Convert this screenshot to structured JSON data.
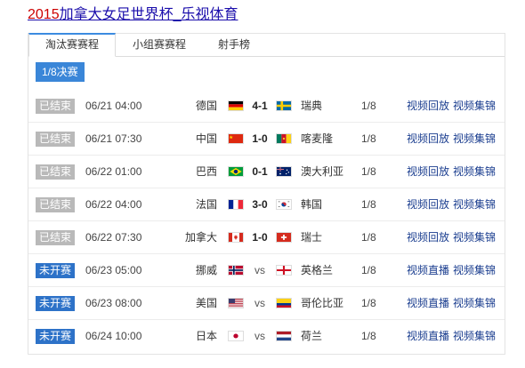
{
  "header": {
    "title_highlight": "2015",
    "title_rest": "加拿大女足世界杯_乐视体育"
  },
  "tabs": [
    {
      "label": "淘汰赛赛程",
      "active": true
    },
    {
      "label": "小组赛赛程",
      "active": false
    },
    {
      "label": "射手榜",
      "active": false
    }
  ],
  "round_label": "1/8决赛",
  "colors": {
    "accent": "#3a86d8",
    "status_done": "#b9b9b9",
    "status_upcoming": "#2d72c8",
    "link": "#1a3d8f"
  },
  "matches": [
    {
      "status": "已结束",
      "state": "done",
      "time": "06/21 04:00",
      "home": "德国",
      "home_flag": "germany-flag",
      "score": "4-1",
      "away": "瑞典",
      "away_flag": "sweden-flag",
      "stage": "1/8",
      "link1": "视频回放",
      "link2": "视频集锦"
    },
    {
      "status": "已结束",
      "state": "done",
      "time": "06/21 07:30",
      "home": "中国",
      "home_flag": "china-flag",
      "score": "1-0",
      "away": "喀麦隆",
      "away_flag": "cameroon-flag",
      "stage": "1/8",
      "link1": "视频回放",
      "link2": "视频集锦"
    },
    {
      "status": "已结束",
      "state": "done",
      "time": "06/22 01:00",
      "home": "巴西",
      "home_flag": "brazil-flag",
      "score": "0-1",
      "away": "澳大利亚",
      "away_flag": "australia-flag",
      "stage": "1/8",
      "link1": "视频回放",
      "link2": "视频集锦"
    },
    {
      "status": "已结束",
      "state": "done",
      "time": "06/22 04:00",
      "home": "法国",
      "home_flag": "france-flag",
      "score": "3-0",
      "away": "韩国",
      "away_flag": "korea-flag",
      "stage": "1/8",
      "link1": "视频回放",
      "link2": "视频集锦"
    },
    {
      "status": "已结束",
      "state": "done",
      "time": "06/22 07:30",
      "home": "加拿大",
      "home_flag": "canada-flag",
      "score": "1-0",
      "away": "瑞士",
      "away_flag": "switzerland-flag",
      "stage": "1/8",
      "link1": "视频回放",
      "link2": "视频集锦"
    },
    {
      "status": "未开赛",
      "state": "upcoming",
      "time": "06/23 05:00",
      "home": "挪威",
      "home_flag": "norway-flag",
      "score": "vs",
      "away": "英格兰",
      "away_flag": "england-flag",
      "stage": "1/8",
      "link1": "视频直播",
      "link2": "视频集锦"
    },
    {
      "status": "未开赛",
      "state": "upcoming",
      "time": "06/23 08:00",
      "home": "美国",
      "home_flag": "usa-flag",
      "score": "vs",
      "away": "哥伦比亚",
      "away_flag": "colombia-flag",
      "stage": "1/8",
      "link1": "视频直播",
      "link2": "视频集锦"
    },
    {
      "status": "未开赛",
      "state": "upcoming",
      "time": "06/24 10:00",
      "home": "日本",
      "home_flag": "japan-flag",
      "score": "vs",
      "away": "荷兰",
      "away_flag": "netherlands-flag",
      "stage": "1/8",
      "link1": "视频直播",
      "link2": "视频集锦"
    }
  ]
}
